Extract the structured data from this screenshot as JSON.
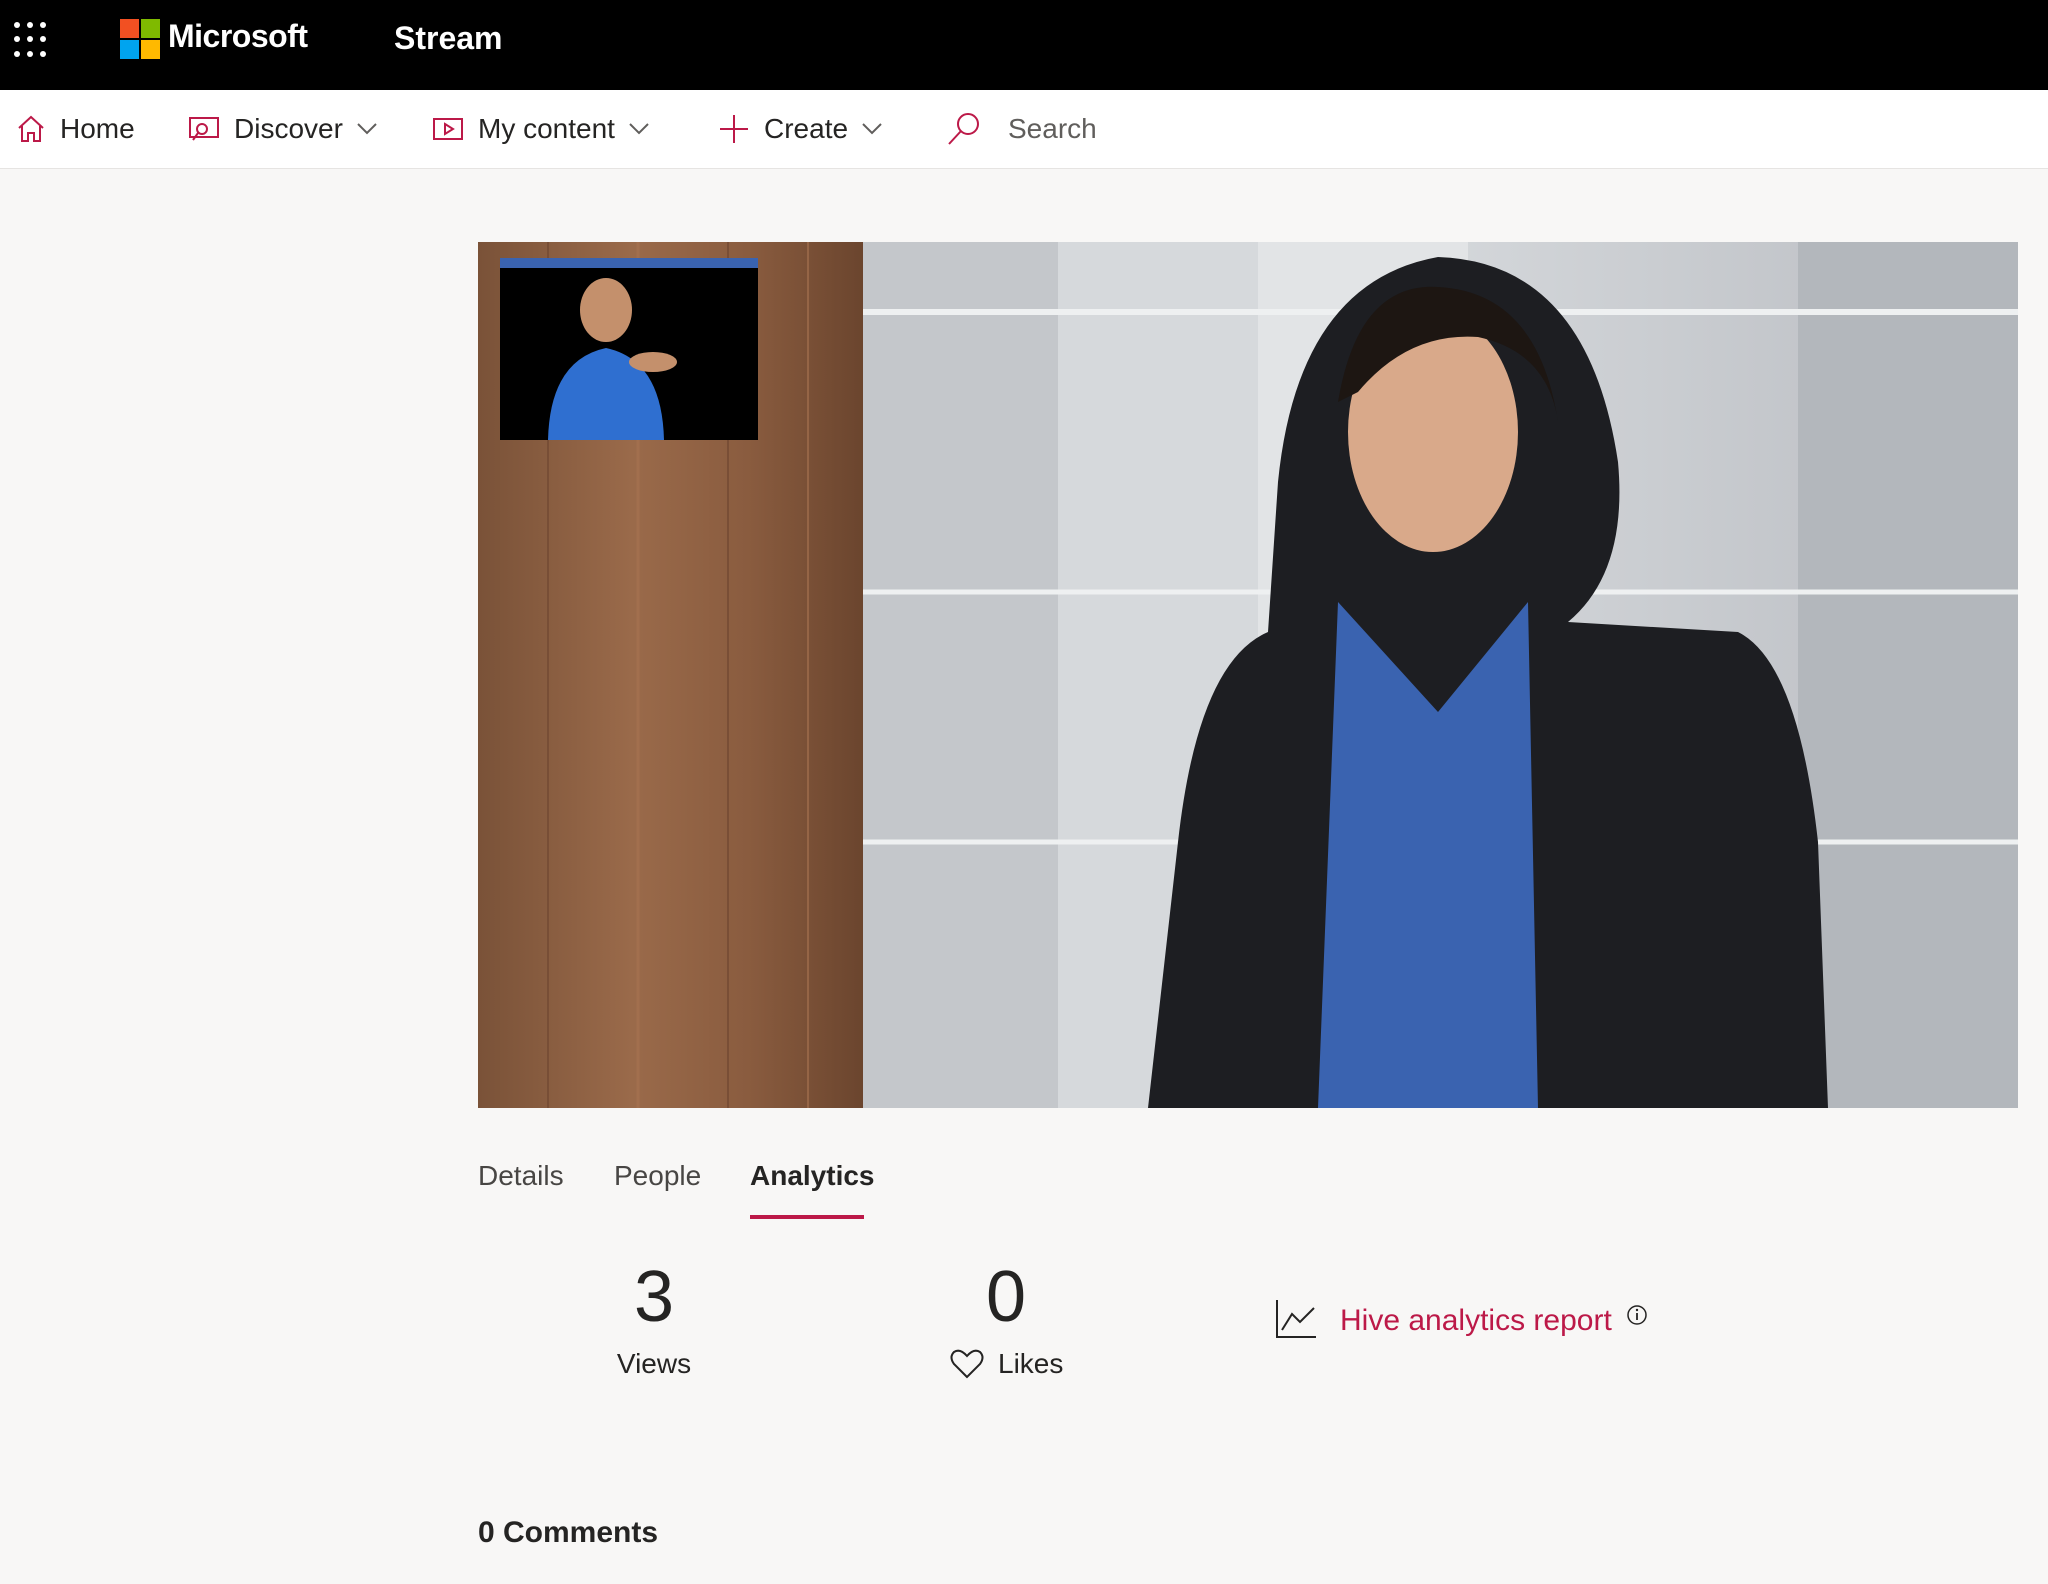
{
  "suitebar": {
    "brand": "Microsoft",
    "app_name": "Stream",
    "logo_colors": [
      "#f25022",
      "#7fba00",
      "#00a4ef",
      "#ffb900"
    ]
  },
  "nav": {
    "accent": "#bc1948",
    "items": [
      {
        "label": "Home",
        "icon": "home-icon"
      },
      {
        "label": "Discover",
        "icon": "discover-icon",
        "dropdown": true
      },
      {
        "label": "My content",
        "icon": "my-content-icon",
        "dropdown": true
      },
      {
        "label": "Create",
        "icon": "plus-icon",
        "dropdown": true
      }
    ],
    "search": {
      "label": "Search",
      "icon": "search-icon"
    }
  },
  "tabs": [
    {
      "label": "Details"
    },
    {
      "label": "People"
    },
    {
      "label": "Analytics",
      "active": true
    }
  ],
  "analytics": {
    "views": {
      "value": "3",
      "label": "Views"
    },
    "likes": {
      "value": "0",
      "label": "Likes"
    },
    "report_link": "Hive analytics report"
  },
  "comments": {
    "title": "0 Comments"
  }
}
